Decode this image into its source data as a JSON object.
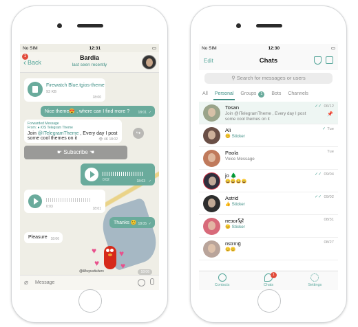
{
  "colors": {
    "accent": "#6aab9c",
    "accent_dark": "#3d8e84",
    "badge_red": "#e24b3a",
    "chat_bg": "#efeee6"
  },
  "left": {
    "status": {
      "carrier": "No SIM",
      "time": "12:31"
    },
    "header": {
      "back_label": "Back",
      "back_badge": "1",
      "title": "Bardia",
      "subtitle": "last seen recently"
    },
    "messages": {
      "file": {
        "name": "Firewatch Blue.tgios-theme",
        "size": "93 KB",
        "time": "18:00"
      },
      "nice": {
        "text": "Nice theme😍 , where can I find more ?",
        "time": "18:01"
      },
      "forward": {
        "header": "Forwarded Message",
        "from": "From: ● iOS Telegram Theme",
        "text_prefix": "Join ",
        "mention": "@ITelegramTheme",
        "text_suffix": " , Every day I post some cool themes on it",
        "meta": "👁 4K 18:02"
      },
      "subscribe_label": "☛ Subscribe ☚",
      "voice_out": {
        "duration": "0:02",
        "time": "18:03"
      },
      "voice_in": {
        "duration": "0:03",
        "time": "18:01"
      },
      "thanks": {
        "text": "Thanks 😊",
        "time": "18:05"
      },
      "pleasure": {
        "text": "Pleasure",
        "time": "18:06"
      },
      "sticker": {
        "caption": "@ilikoyustickers",
        "time": "18:06"
      }
    },
    "input_placeholder": "Message"
  },
  "right": {
    "status": {
      "carrier": "No SIM",
      "time": "12:30"
    },
    "nav": {
      "edit": "Edit",
      "title": "Chats"
    },
    "search_placeholder": "Search for messages or users",
    "tabs": [
      {
        "label": "All"
      },
      {
        "label": "Personal",
        "active": true
      },
      {
        "label": "Groups",
        "count": "1"
      },
      {
        "label": "Bots"
      },
      {
        "label": "Channels"
      }
    ],
    "chats": [
      {
        "name": "Tosan",
        "preview": "Join @ITelegramTheme , Every day I post some cool themes on it",
        "date": "06/12",
        "read": true,
        "pinned": true,
        "avatar": "#9aa48a"
      },
      {
        "name": "Ali",
        "preview": "😊 Sticker",
        "date": "Tue",
        "read": true,
        "avatar": "#6a4f46"
      },
      {
        "name": "Paola",
        "preview": "Voice Message",
        "date": "Tue",
        "read": false,
        "avatar": "#c07a5c"
      },
      {
        "name": "jo 🌲",
        "preview": "😄😄😄😄",
        "date": "09/04",
        "read": true,
        "avatar": "#2f2f3c"
      },
      {
        "name": "Astrid",
        "preview": "👍 Sticker",
        "date": "09/02",
        "read": true,
        "avatar": "#2d2d2d"
      },
      {
        "name": "пезог🐼",
        "preview": "😊 Sticker",
        "date": "08/31",
        "read": false,
        "avatar": "#d86a7a"
      },
      {
        "name": "пstrmḡ",
        "preview": "😊😊",
        "date": "08/27",
        "read": false,
        "avatar": "#b9a49a"
      }
    ],
    "tabbar": [
      {
        "label": "Contacts",
        "icon": "contacts-icon"
      },
      {
        "label": "Chats",
        "icon": "chats-icon",
        "badge": "1"
      },
      {
        "label": "Settings",
        "icon": "gear-icon"
      }
    ]
  }
}
